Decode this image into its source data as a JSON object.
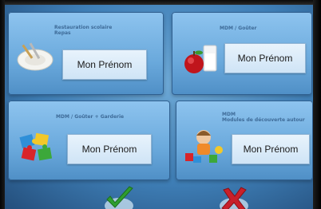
{
  "tiles": [
    {
      "caption_line1": "Restauration scolaire",
      "caption_line2": "Repas",
      "name_label": "Mon Prénom",
      "icon": "plate-cutlery-icon"
    },
    {
      "caption_line1": "MDM / Goûter",
      "name_label": "Mon Prénom",
      "icon": "apple-glass-icon"
    },
    {
      "caption_line1": "MDM / Goûter + Garderie",
      "name_label": "Mon Prénom",
      "icon": "puzzle-icon"
    },
    {
      "caption_line1": "MDM",
      "caption_line2": "Modules de découverte autour",
      "name_label": "Mon Prénom",
      "icon": "toys-icon"
    }
  ],
  "actions": {
    "confirm_icon": "checkmark-icon",
    "cancel_icon": "cross-icon",
    "confirm_color": "#2f9e2f",
    "cancel_color": "#c8202a"
  }
}
